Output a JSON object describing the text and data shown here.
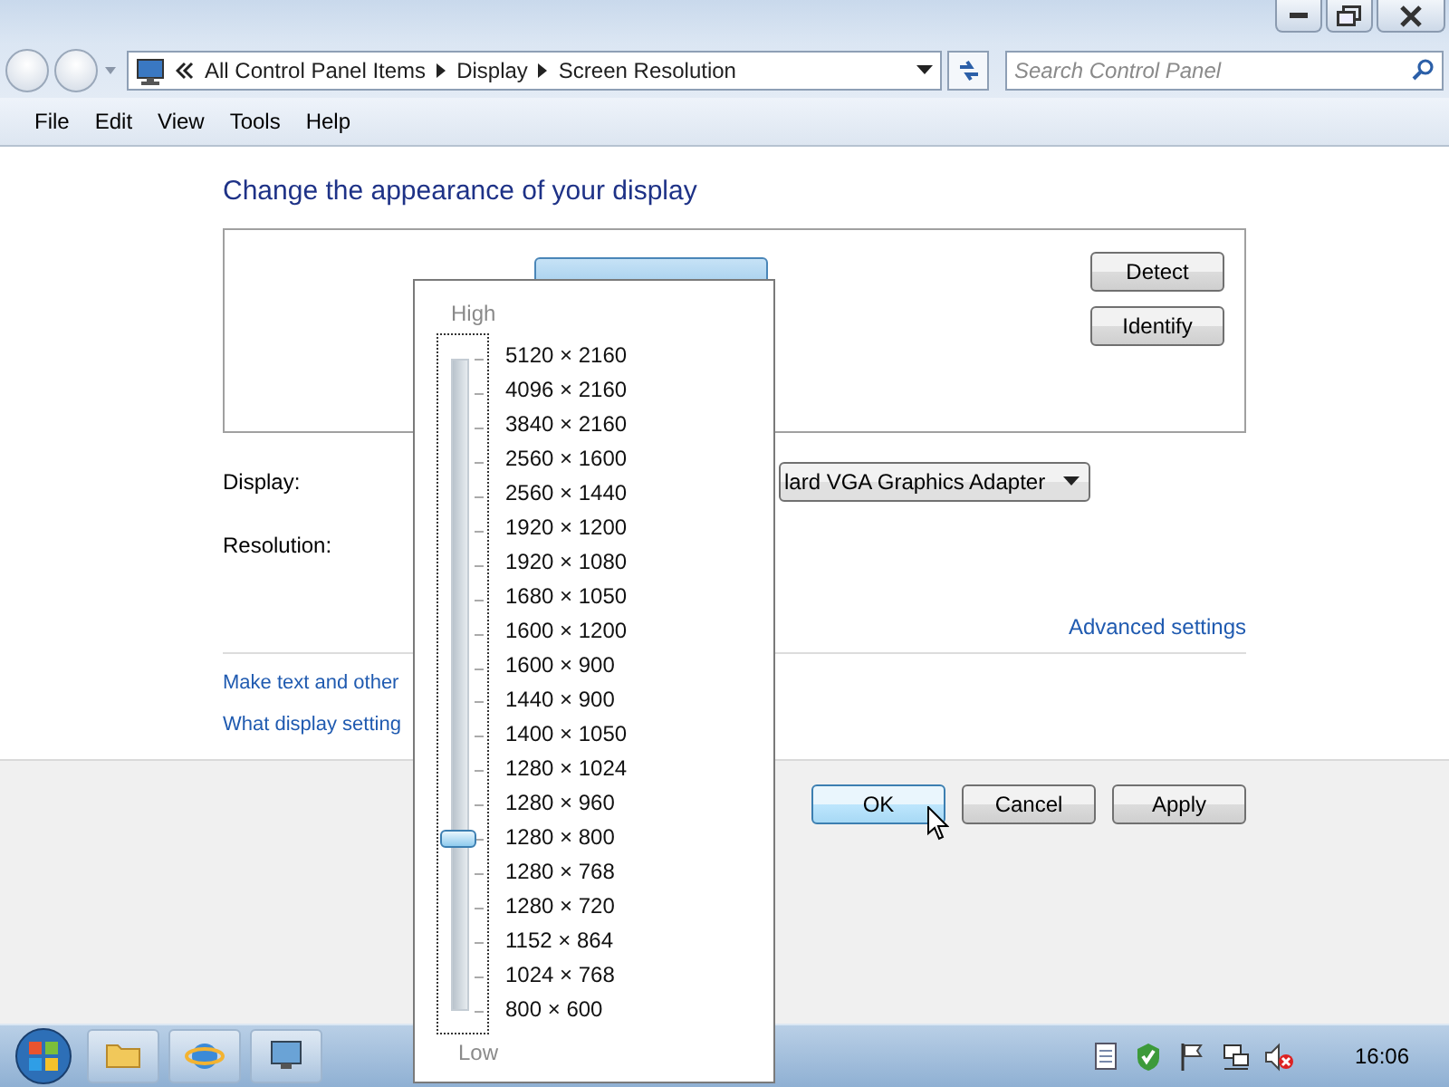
{
  "address_bar": {
    "breadcrumbs": [
      "All Control Panel Items",
      "Display",
      "Screen Resolution"
    ]
  },
  "search": {
    "placeholder": "Search Control Panel"
  },
  "menu_bar": [
    "File",
    "Edit",
    "View",
    "Tools",
    "Help"
  ],
  "heading": "Change the appearance of your display",
  "monitor_buttons": [
    "Detect",
    "Identify"
  ],
  "display": {
    "label": "Display:",
    "value": "lard VGA Graphics Adapter"
  },
  "resolution": {
    "label": "Resolution:"
  },
  "advanced_link": "Advanced settings",
  "links": [
    "Make text and other",
    "What display setting"
  ],
  "dialog_buttons": [
    {
      "label": "OK",
      "hovered": true
    },
    {
      "label": "Cancel",
      "hovered": false
    },
    {
      "label": "Apply",
      "hovered": false
    }
  ],
  "resolution_popup": {
    "high_label": "High",
    "low_label": "Low",
    "slider": {
      "level": 0.2632
    },
    "options": [
      "5120 × 2160",
      "4096 × 2160",
      "3840 × 2160",
      "2560 × 1600",
      "2560 × 1440",
      "1920 × 1200",
      "1920 × 1080",
      "1680 × 1050",
      "1600 × 1200",
      "1600 × 900",
      "1440 × 900",
      "1400 × 1050",
      "1280 × 1024",
      "1280 × 960",
      "1280 × 800",
      "1280 × 768",
      "1280 × 720",
      "1152 × 864",
      "1024 × 768",
      "800 × 600"
    ]
  },
  "taskbar": {
    "clock": "16:06"
  }
}
